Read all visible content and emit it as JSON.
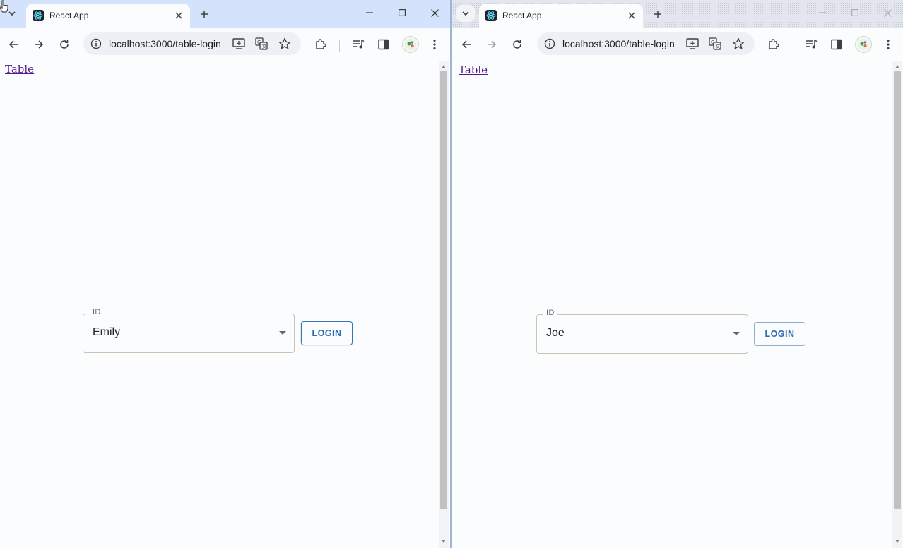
{
  "windows": [
    {
      "tab": {
        "title": "React App"
      },
      "omnibox": {
        "url": "localhost:3000/table-login"
      },
      "page": {
        "link": "Table",
        "select": {
          "label": "ID",
          "value": "Emily"
        },
        "login_button": "LOGIN"
      }
    },
    {
      "tab": {
        "title": "React App"
      },
      "omnibox": {
        "url": "localhost:3000/table-login"
      },
      "page": {
        "link": "Table",
        "select": {
          "label": "ID",
          "value": "Joe"
        },
        "login_button": "LOGIN"
      }
    }
  ],
  "icons": {
    "favicon": "react-logo-icon",
    "controls": [
      "chevron-down-icon",
      "close-icon",
      "plus-icon",
      "minimize-icon",
      "maximize-icon",
      "back-icon",
      "forward-icon",
      "reload-icon",
      "info-icon",
      "install-icon",
      "translate-icon",
      "star-icon",
      "extensions-icon",
      "media-icon",
      "sidepanel-icon",
      "avatar",
      "menu-icon"
    ]
  },
  "colors": {
    "active_tabstrip": "#d4e3fb",
    "inactive_tabstrip": "#e3e6ee",
    "link": "#551a8b",
    "button_text": "#2d6bb1"
  }
}
